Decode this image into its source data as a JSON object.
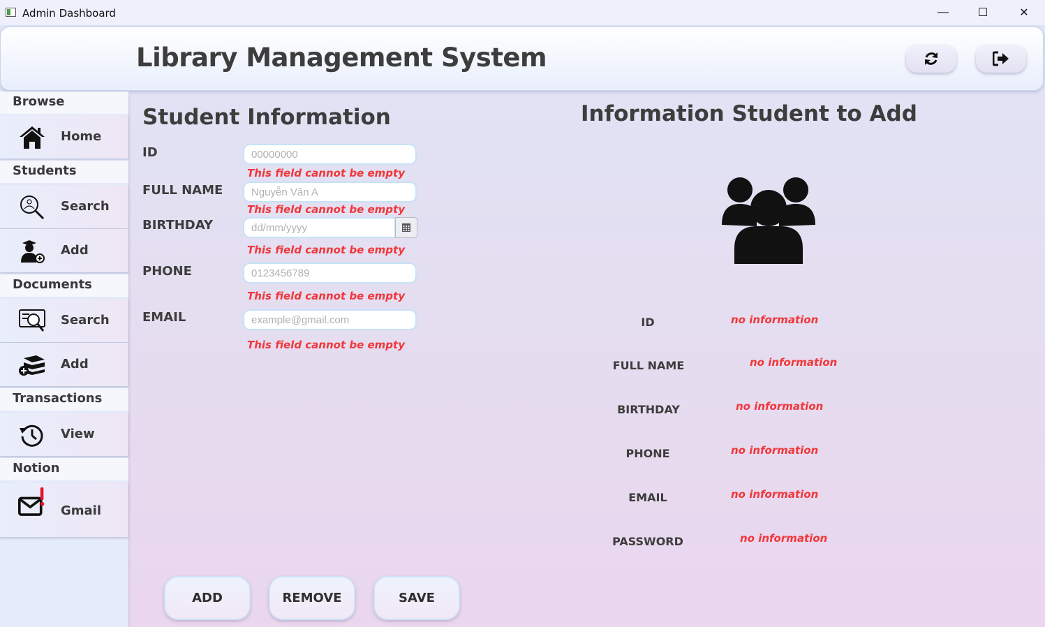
{
  "window": {
    "title": "Admin Dashboard",
    "minimize": "—",
    "maximize": "☐",
    "close": "✕"
  },
  "header": {
    "title": "Library Management System",
    "refresh_icon": "refresh-icon",
    "logout_icon": "logout-icon"
  },
  "sidebar": {
    "browse": "Browse",
    "home": "Home",
    "students": "Students",
    "students_search": "Search",
    "students_add": "Add",
    "documents": "Documents",
    "documents_search": "Search",
    "documents_add": "Add",
    "transactions": "Transactions",
    "view": "View",
    "notion": "Notion",
    "gmail": "Gmail"
  },
  "form": {
    "title": "Student Information",
    "id_label": "ID",
    "id_placeholder": "00000000",
    "fullname_label": "FULL NAME",
    "fullname_placeholder": "Nguyễn Văn A",
    "birthday_label": "BIRTHDAY",
    "birthday_placeholder": "dd/mm/yyyy",
    "phone_label": "PHONE",
    "phone_placeholder": "0123456789",
    "email_label": "EMAIL",
    "email_placeholder": "example@gmail.com",
    "error_message": "This field cannot be empty"
  },
  "info": {
    "title": "Information Student to Add",
    "id_label": "ID",
    "fullname_label": "FULL NAME",
    "birthday_label": "BIRTHDAY",
    "phone_label": "PHONE",
    "email_label": "EMAIL",
    "password_label": "PASSWORD",
    "no_info": "no information"
  },
  "actions": {
    "add": "ADD",
    "remove": "REMOVE",
    "save": "SAVE"
  },
  "colors": {
    "error": "#f0373a",
    "accent_border": "#c6e2f6"
  }
}
